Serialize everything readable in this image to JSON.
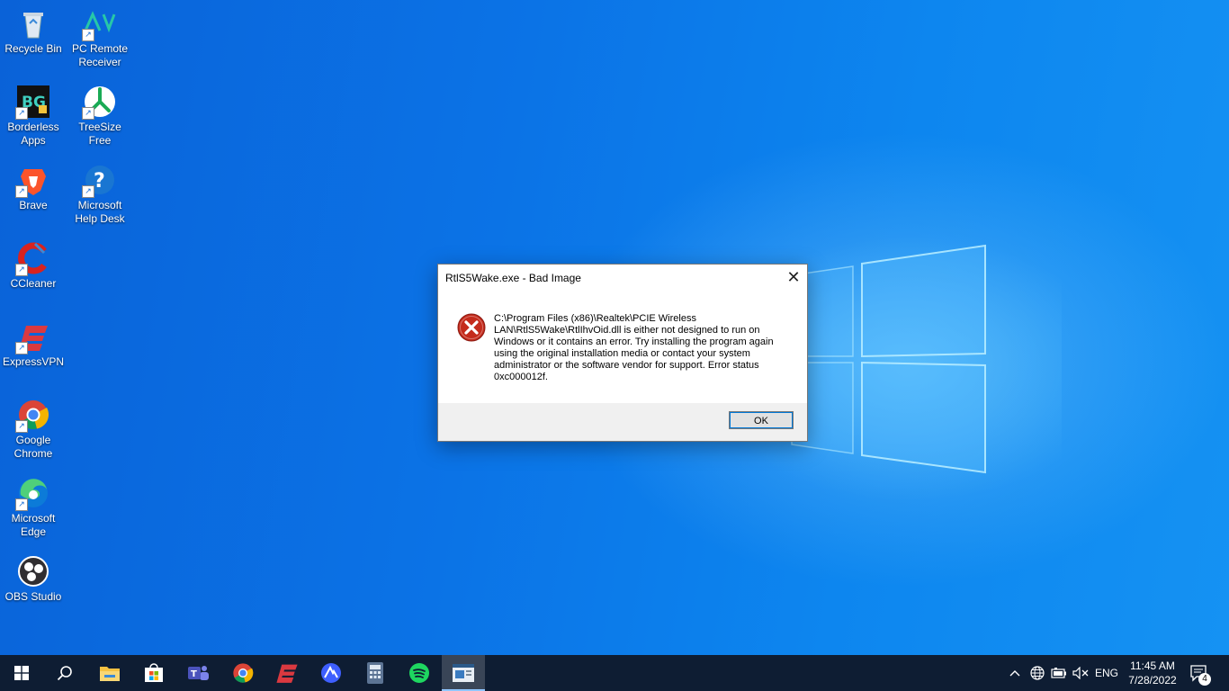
{
  "desktop": {
    "icons": [
      {
        "label": "Recycle Bin"
      },
      {
        "label": "PC Remote Receiver"
      },
      {
        "label": "Borderless Apps"
      },
      {
        "label": "TreeSize Free"
      },
      {
        "label": "Brave"
      },
      {
        "label": "Microsoft Help Desk"
      },
      {
        "label": "CCleaner"
      },
      {
        "label": "ExpressVPN"
      },
      {
        "label": "Google Chrome"
      },
      {
        "label": "Microsoft Edge"
      },
      {
        "label": "OBS Studio"
      }
    ],
    "wallpaper_color": "#0b73e6"
  },
  "dialog": {
    "title": "RtlS5Wake.exe - Bad Image",
    "close_glyph": "✕",
    "message": "C:\\Program Files (x86)\\Realtek\\PCIE Wireless LAN\\RtlS5Wake\\RtlIhvOid.dll is either not designed to run on Windows or it contains an error. Try installing the program again using the original installation media or contact your system administrator or the software vendor for support. Error status 0xc000012f.",
    "ok_label": "OK",
    "error_icon": "error-circle-x-icon"
  },
  "taskbar": {
    "apps": [
      "start",
      "search",
      "file-explorer",
      "microsoft-store",
      "teams",
      "chrome",
      "expressvpn",
      "nordvpn",
      "calculator",
      "spotify",
      "active-app"
    ],
    "tray": {
      "language": "ENG",
      "time": "11:45 AM",
      "date": "7/28/2022",
      "notification_count": "4"
    },
    "background": "#0e1d33"
  }
}
